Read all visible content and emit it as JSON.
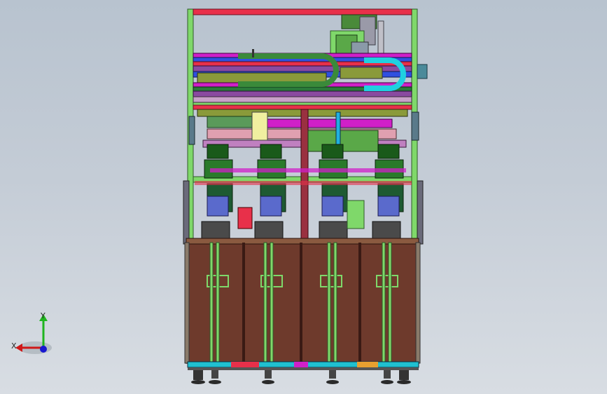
{
  "viewport": {
    "background_top": "#b8c3cf",
    "background_bottom": "#d8dde3"
  },
  "triad": {
    "x_label": "X",
    "y_label": "Y",
    "x_color": "#d01818",
    "y_color": "#1fb51f",
    "z_color": "#1818d0"
  },
  "colors": {
    "frame": "#7fd86a",
    "frame_edge": "#2f5a28",
    "cabinet": "#6e3a2c",
    "rail_red": "#e8304a",
    "rail_magenta": "#d020c8",
    "rail_blue": "#3050e0",
    "cyan": "#20d0e0",
    "olive": "#8a9a3a",
    "purple": "#8a4aa0",
    "pink": "#f2a0c8",
    "steel": "#8a9aa8"
  }
}
